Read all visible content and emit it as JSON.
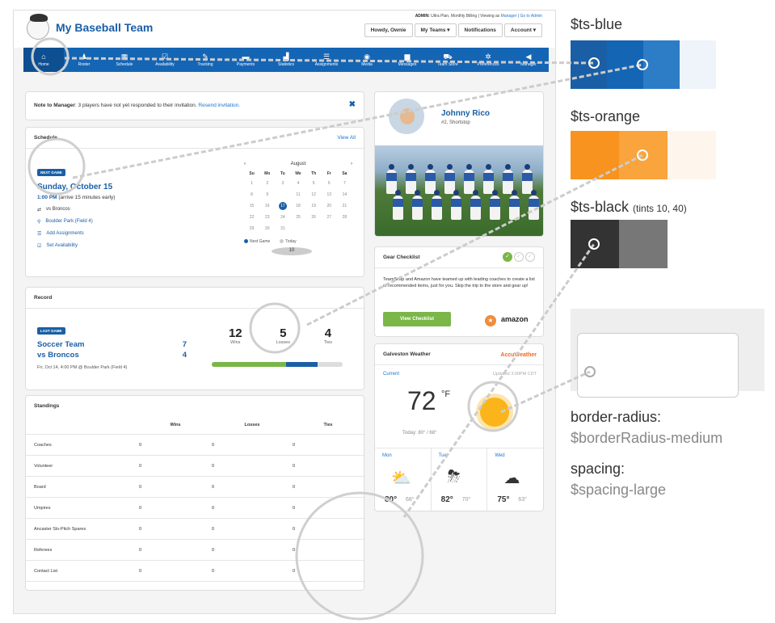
{
  "header": {
    "team_name": "My Baseball Team",
    "admin_prefix": "ADMIN:",
    "admin_text": " Ultra Plan, Monthly Billing | Viewing as ",
    "admin_manager": "Manager",
    "admin_sep": " | ",
    "admin_goto": "Go to Admin",
    "buttons": [
      "Howdy, Ownie",
      "My Teams ▾",
      "Notifications",
      "Account ▾"
    ]
  },
  "nav": [
    {
      "label": "Home",
      "icon": "⌂"
    },
    {
      "label": "Roster",
      "icon": "♟"
    },
    {
      "label": "Schedule",
      "icon": "▦"
    },
    {
      "label": "Availability",
      "icon": "☑"
    },
    {
      "label": "Tracking",
      "icon": "✎"
    },
    {
      "label": "Payments",
      "icon": "▬"
    },
    {
      "label": "Statistics",
      "icon": "▟"
    },
    {
      "label": "Assignments",
      "icon": "☰"
    },
    {
      "label": "Media",
      "icon": "◉"
    },
    {
      "label": "Messages",
      "icon": "▆"
    },
    {
      "label": "Team Store",
      "icon": "⛟"
    },
    {
      "label": "Preferences",
      "icon": "✲"
    },
    {
      "label": "Manager",
      "icon": "◀"
    }
  ],
  "note": {
    "prefix": "Note to Manager",
    "text": ": 3 players have not yet responded to their invitation. ",
    "link": "Resend invitation."
  },
  "schedule": {
    "title": "Schedule",
    "view_all": "View All",
    "badge": "NEXT GAME",
    "date": "Sunday, October 15",
    "time": "1:00 PM",
    "arrive": "(arrive 15 minutes early)",
    "rows": [
      "vs Broncos",
      "Boulder Park (Field 4)",
      "Add Assignments",
      "Set Availability"
    ],
    "calendar": {
      "month": "August",
      "dow": [
        "Su",
        "Mo",
        "Tu",
        "We",
        "Th",
        "Fr",
        "Sa"
      ],
      "days": [
        "1",
        "2",
        "3",
        "4",
        "5",
        "6",
        "7",
        "8",
        "9",
        "10",
        "11",
        "12",
        "13",
        "14",
        "15",
        "16",
        "17",
        "18",
        "19",
        "20",
        "21",
        "22",
        "23",
        "24",
        "25",
        "26",
        "27",
        "28",
        "29",
        "30",
        "31"
      ],
      "today": "10",
      "next_game": "17",
      "legend_next": "Next Game",
      "legend_today": "Today"
    }
  },
  "record": {
    "title": "Record",
    "badge": "LAST GAME",
    "team1": "Soccer Team",
    "score1": "7",
    "team2": "vs Broncos",
    "score2": "4",
    "meta": "Fri, Oct 14, 4:00 PM @ Boulder Park (Field 4)",
    "wins": "12",
    "losses": "5",
    "ties": "4",
    "wins_label": "Wins",
    "losses_label": "Losses",
    "ties_label": "Ties",
    "win_fraction": 0.57,
    "loss_fraction": 0.24
  },
  "standings": {
    "title": "Standings",
    "headers": [
      "",
      "Wins",
      "Losses",
      "Ties"
    ],
    "rows": [
      [
        "Coaches",
        "0",
        "0",
        "0"
      ],
      [
        "Volunteer",
        "0",
        "0",
        "0"
      ],
      [
        "Board",
        "0",
        "0",
        "0"
      ],
      [
        "Umpires",
        "0",
        "0",
        "0"
      ],
      [
        "Ancaster Slo-Pitch Spares",
        "0",
        "0",
        "0"
      ],
      [
        "Referees",
        "0",
        "0",
        "0"
      ],
      [
        "Contact List",
        "0",
        "0",
        "0"
      ]
    ]
  },
  "player": {
    "name": "Johnny Rico",
    "detail": "#2, Shortstop"
  },
  "gear": {
    "title": "Gear Checklist",
    "text": "TeamSnap and Amazon have teamed up with leading coaches to create a list of recommended items, just for you. Skip the trip to the store and gear up!",
    "button": "View Checklist",
    "amazon": "amazon"
  },
  "weather": {
    "title": "Galveston Weather",
    "provider": "AccuWeather",
    "current": "Current",
    "updated": "Updated 3:00PM CDT",
    "temp": "72",
    "unit": "°F",
    "today": "Today: 80° / 68°",
    "forecast": [
      {
        "day": "Mon",
        "hi": "80°",
        "lo": "68°",
        "icon": "⛅"
      },
      {
        "day": "Tue",
        "hi": "82°",
        "lo": "70°",
        "icon": "⛈"
      },
      {
        "day": "Wed",
        "hi": "75°",
        "lo": "63°",
        "icon": "☁"
      }
    ]
  },
  "annotations": {
    "blue_label": "$ts-blue",
    "orange_label": "$ts-orange",
    "black_label": "$ts-black",
    "black_note": "(tints 10, 40)",
    "radius_label": "border-radius:",
    "radius_value": "$borderRadius-medium",
    "spacing_label": "spacing:",
    "spacing_value": "$spacing-large",
    "blue_swatches": [
      "#1a5fa6",
      "#1565b5",
      "#2d7cc6",
      "#eef4fa"
    ],
    "orange_swatches": [
      "#f7931e",
      "#f9a43c",
      "#fef6ed"
    ],
    "black_swatches": [
      "#333333",
      "#777777"
    ]
  }
}
